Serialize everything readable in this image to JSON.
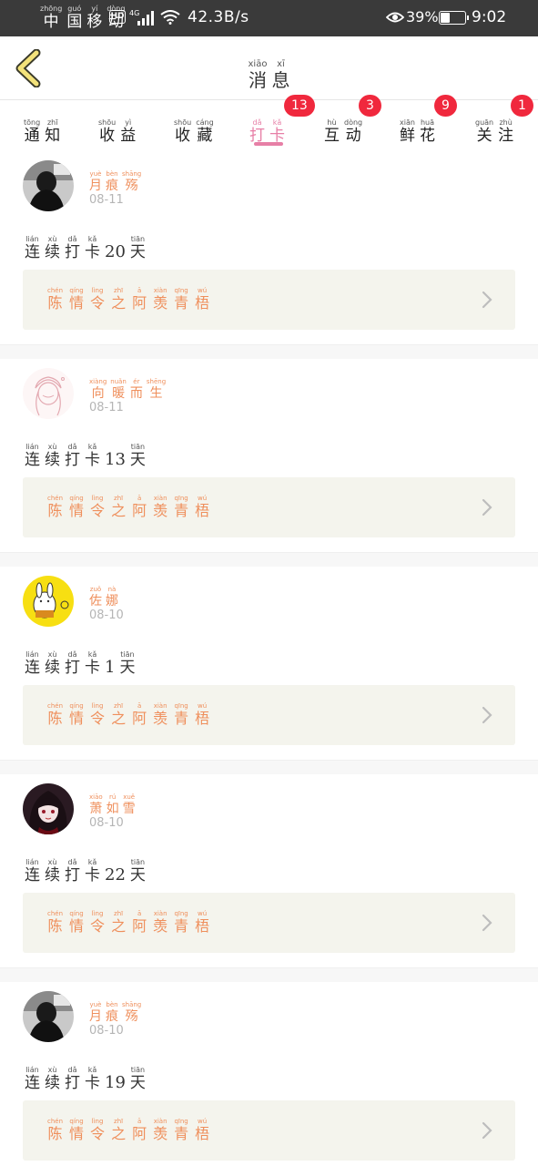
{
  "status_bar": {
    "carrier": [
      [
        "zhōng",
        "中"
      ],
      [
        "guó",
        "国"
      ],
      [
        "yí",
        "移"
      ],
      [
        "dòng",
        "动"
      ]
    ],
    "hd": "HD",
    "network": "4G",
    "speed": "42.3B/s",
    "battery": "39%",
    "battery_level": 0.39,
    "time": "9:02"
  },
  "header": {
    "title": [
      [
        "xiāo",
        "消"
      ],
      [
        "xī",
        "息"
      ]
    ]
  },
  "tabs": [
    {
      "chars": [
        [
          "tōng",
          "通"
        ],
        [
          "zhī",
          "知"
        ]
      ],
      "badge": ""
    },
    {
      "chars": [
        [
          "shōu",
          "收"
        ],
        [
          "yì",
          "益"
        ]
      ],
      "badge": ""
    },
    {
      "chars": [
        [
          "shōu",
          "收"
        ],
        [
          "cáng",
          "藏"
        ]
      ],
      "badge": ""
    },
    {
      "chars": [
        [
          "dǎ",
          "打"
        ],
        [
          "kǎ",
          "卡"
        ]
      ],
      "badge": "13",
      "active": true
    },
    {
      "chars": [
        [
          "hù",
          "互"
        ],
        [
          "dòng",
          "动"
        ]
      ],
      "badge": "3"
    },
    {
      "chars": [
        [
          "xiān",
          "鲜"
        ],
        [
          "huā",
          "花"
        ]
      ],
      "badge": "9"
    },
    {
      "chars": [
        [
          "guān",
          "关"
        ],
        [
          "zhù",
          "注"
        ]
      ],
      "badge": "1"
    }
  ],
  "streak_prefix": [
    [
      "lián",
      "连"
    ],
    [
      "xù",
      "续"
    ],
    [
      "dǎ",
      "打"
    ],
    [
      "kǎ",
      "卡"
    ]
  ],
  "streak_suffix": [
    [
      "tiān",
      "天"
    ]
  ],
  "feed": [
    {
      "avatar": "avatar-dark-photo",
      "name": [
        [
          "yuè",
          "月"
        ],
        [
          "bèn",
          "痕"
        ],
        [
          "shāng",
          "殇"
        ]
      ],
      "date": "08-11",
      "days": "20",
      "topic": [
        [
          "chén",
          "陈"
        ],
        [
          "qíng",
          "情"
        ],
        [
          "lìng",
          "令"
        ],
        [
          "zhī",
          "之"
        ],
        [
          "ā",
          "阿"
        ],
        [
          "xiàn",
          "羡"
        ],
        [
          "qīng",
          "青"
        ],
        [
          "wú",
          "梧"
        ]
      ]
    },
    {
      "avatar": "avatar-sketch-girl",
      "name": [
        [
          "xiàng",
          "向"
        ],
        [
          "nuǎn",
          "暖"
        ],
        [
          "ér",
          "而"
        ],
        [
          "shēng",
          "生"
        ]
      ],
      "date": "08-11",
      "days": "13",
      "topic": [
        [
          "chén",
          "陈"
        ],
        [
          "qíng",
          "情"
        ],
        [
          "lìng",
          "令"
        ],
        [
          "zhī",
          "之"
        ],
        [
          "ā",
          "阿"
        ],
        [
          "xiàn",
          "羡"
        ],
        [
          "qīng",
          "青"
        ],
        [
          "wú",
          "梧"
        ]
      ]
    },
    {
      "avatar": "avatar-yellow-bunny",
      "name": [
        [
          "zuǒ",
          "佐"
        ],
        [
          "nà",
          "娜"
        ]
      ],
      "date": "08-10",
      "days": "1",
      "topic": [
        [
          "chén",
          "陈"
        ],
        [
          "qíng",
          "情"
        ],
        [
          "lìng",
          "令"
        ],
        [
          "zhī",
          "之"
        ],
        [
          "ā",
          "阿"
        ],
        [
          "xiàn",
          "羡"
        ],
        [
          "qīng",
          "青"
        ],
        [
          "wú",
          "梧"
        ]
      ]
    },
    {
      "avatar": "avatar-anime-girl",
      "name": [
        [
          "xiāo",
          "萧"
        ],
        [
          "rú",
          "如"
        ],
        [
          "xuě",
          "雪"
        ]
      ],
      "date": "08-10",
      "days": "22",
      "topic": [
        [
          "chén",
          "陈"
        ],
        [
          "qíng",
          "情"
        ],
        [
          "lìng",
          "令"
        ],
        [
          "zhī",
          "之"
        ],
        [
          "ā",
          "阿"
        ],
        [
          "xiàn",
          "羡"
        ],
        [
          "qīng",
          "青"
        ],
        [
          "wú",
          "梧"
        ]
      ]
    },
    {
      "avatar": "avatar-dark-photo",
      "name": [
        [
          "yuè",
          "月"
        ],
        [
          "bèn",
          "痕"
        ],
        [
          "shāng",
          "殇"
        ]
      ],
      "date": "08-10",
      "days": "19",
      "topic": [
        [
          "chén",
          "陈"
        ],
        [
          "qíng",
          "情"
        ],
        [
          "lìng",
          "令"
        ],
        [
          "zhī",
          "之"
        ],
        [
          "ā",
          "阿"
        ],
        [
          "xiàn",
          "羡"
        ],
        [
          "qīng",
          "青"
        ],
        [
          "wú",
          "梧"
        ]
      ]
    }
  ],
  "colors": {
    "accent_pink": "#e77fa6",
    "name_orange": "#ef8f5c",
    "badge_red": "#f0283d",
    "back_arrow_yellow": "#f3e27a"
  }
}
